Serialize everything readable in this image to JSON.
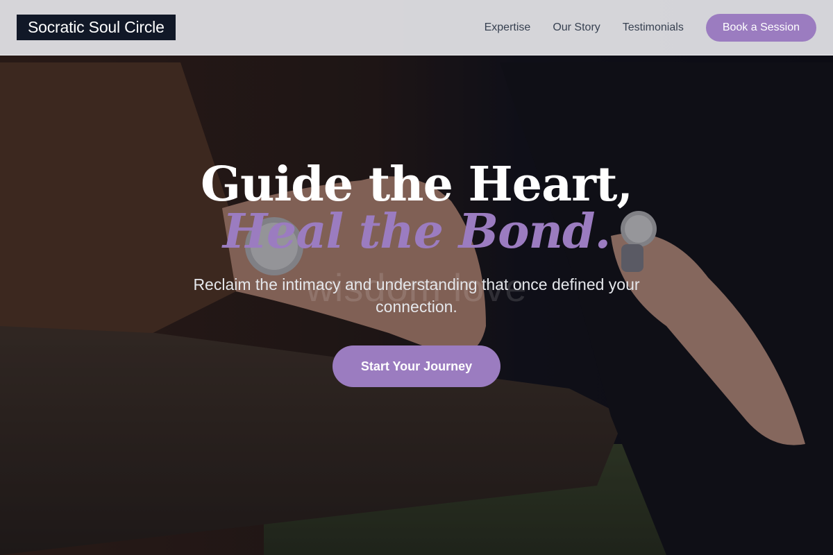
{
  "header": {
    "brand": "Socratic Soul Circle",
    "nav": [
      {
        "label": "Expertise"
      },
      {
        "label": "Our Story"
      },
      {
        "label": "Testimonials"
      }
    ],
    "cta_label": "Book a Session"
  },
  "hero": {
    "headline_line1": "Guide the Heart,",
    "headline_line2": "Heal the Bond.",
    "watermark": "wisdom love",
    "subheadline": "Reclaim the intimacy and understanding that once defined your connection.",
    "cta_label": "Start Your Journey",
    "background_image": "couple-holding-hands-image"
  },
  "colors": {
    "accent": "#9b7cc0",
    "logo_bg": "#111827",
    "nav_text": "#374151"
  }
}
